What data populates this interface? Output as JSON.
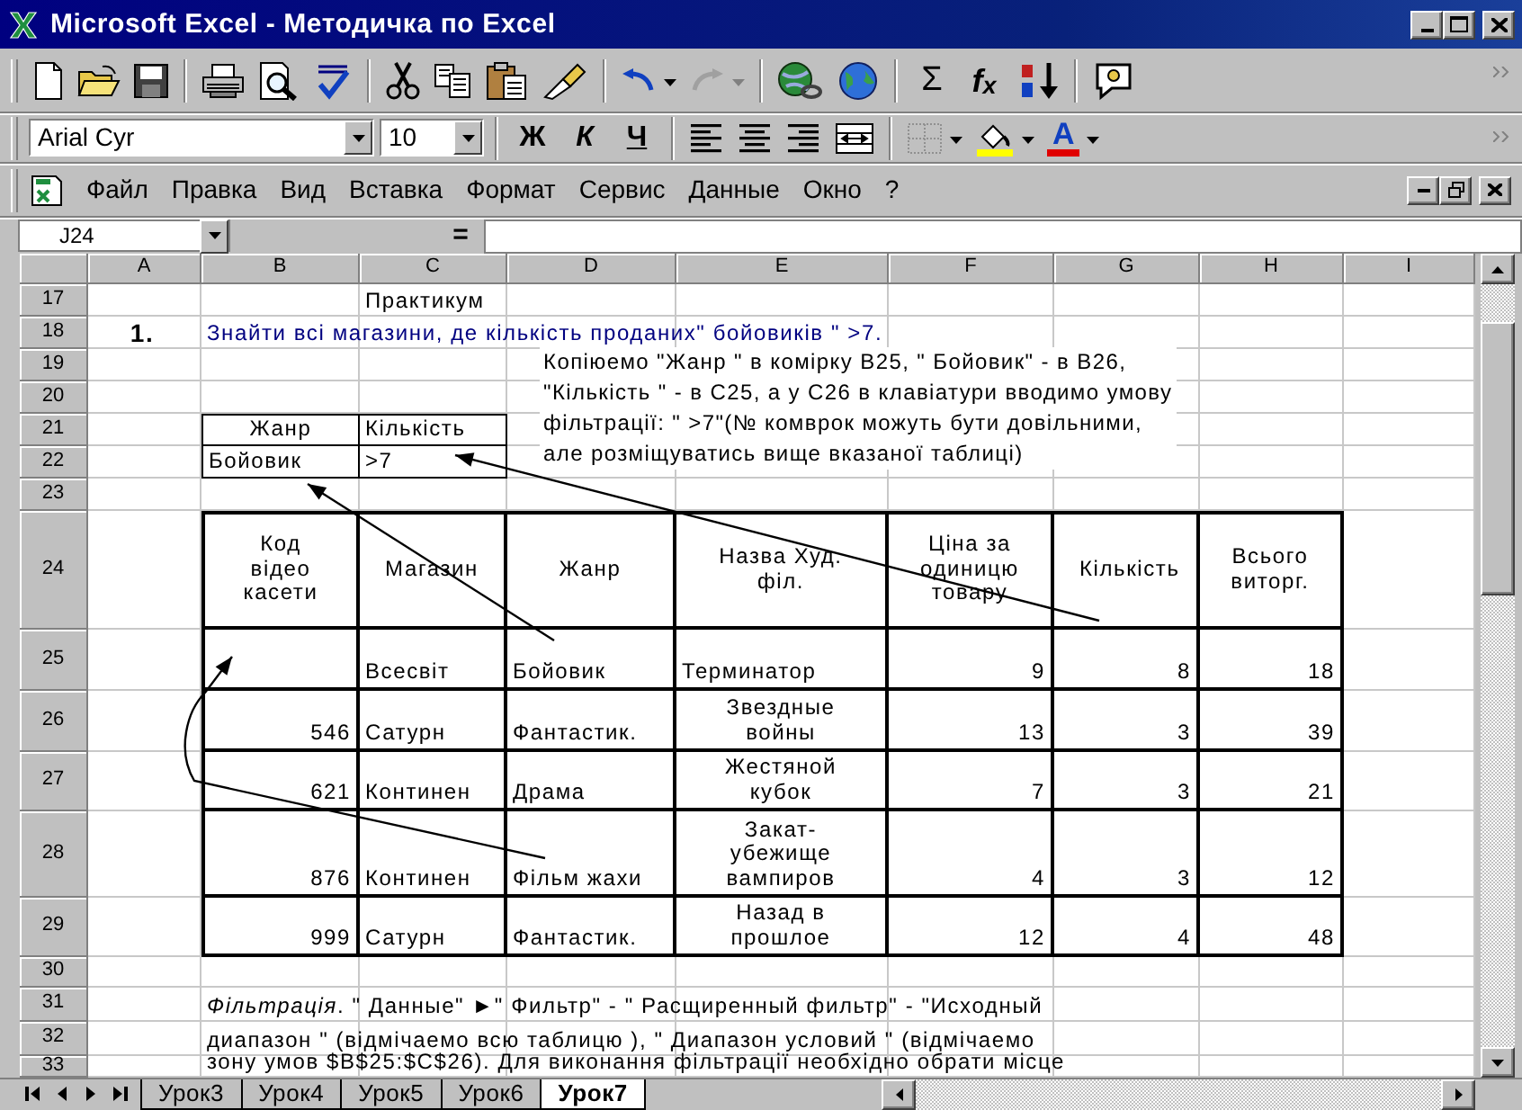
{
  "window": {
    "title": "Microsoft Excel - Методичка по Excel"
  },
  "standard_toolbar": {
    "sum_label": "Σ",
    "function_label": "f$_{x}$"
  },
  "formatting_toolbar": {
    "font": "Arial Cyr",
    "size": "10",
    "bold_label": "Ж",
    "italic_label": "К",
    "underline_label": "Ч",
    "font_color_label": "A"
  },
  "menu": [
    {
      "label": "Файл"
    },
    {
      "label": "Правка"
    },
    {
      "label": "Вид"
    },
    {
      "label": "Вставка"
    },
    {
      "label": "Формат"
    },
    {
      "label": "Сервис"
    },
    {
      "label": "Данные"
    },
    {
      "label": "Окно"
    },
    {
      "label": "?"
    }
  ],
  "formula_bar": {
    "name_box": "J24",
    "equals": "="
  },
  "sheet": {
    "columns": [
      "A",
      "B",
      "C",
      "D",
      "E",
      "F",
      "G",
      "H",
      "I"
    ],
    "rows": [
      {
        "number": "17",
        "cells": {
          "C": {
            "kind": "text",
            "text": "Практикум"
          }
        }
      },
      {
        "number": "18",
        "cells": {
          "A": {
            "kind": "index",
            "text": "1."
          },
          "B": {
            "kind": "task",
            "text": "Знайти всі магазини, де кількість проданих\" бойовиків \" >7."
          }
        }
      },
      {
        "number": "19"
      },
      {
        "number": "20"
      },
      {
        "number": "21",
        "cells": {
          "B": {
            "kind": "center",
            "text": "Жанр",
            "framed": true
          },
          "C": {
            "kind": "text",
            "text": "Кількість",
            "framed": true
          }
        }
      },
      {
        "number": "22",
        "cells": {
          "B": {
            "kind": "text",
            "text": "Бойовик",
            "framed": true
          },
          "C": {
            "kind": "text",
            "text": ">7",
            "framed": true
          }
        }
      },
      {
        "number": "23"
      },
      {
        "number": "24",
        "cells": {
          "B": {
            "kind": "heading",
            "text": "Код відео касети",
            "framed": true,
            "bold_frame": true
          },
          "C": {
            "kind": "heading",
            "text": "Магазин",
            "framed": true,
            "bold_frame": true
          },
          "D": {
            "kind": "heading",
            "text": "Жанр",
            "framed": true,
            "bold_frame": true
          },
          "E": {
            "kind": "heading",
            "text": "Назва Худ. філ.",
            "framed": true,
            "bold_frame": true
          },
          "F": {
            "kind": "heading",
            "text": "Ціна за одиницю товару",
            "framed": true,
            "bold_frame": true
          },
          "G": {
            "kind": "heading",
            "text": "Кількість",
            "framed": true,
            "bold_frame": true
          },
          "H": {
            "kind": "heading",
            "text": "Всього виторг.",
            "framed": true,
            "bold_frame": true
          }
        }
      },
      {
        "number": "25",
        "cells": {
          "B": {
            "kind": "text",
            "framed": true,
            "bold_frame": true
          },
          "C": {
            "kind": "text",
            "text": "Всесвіт",
            "framed": true,
            "bold_frame": true
          },
          "D": {
            "kind": "text",
            "text": "Бойовик",
            "framed": true,
            "bold_frame": true
          },
          "E": {
            "kind": "text",
            "text": "Терминатор",
            "framed": true,
            "bold_frame": true
          },
          "F": {
            "kind": "number",
            "text": "9",
            "framed": true,
            "bold_frame": true
          },
          "G": {
            "kind": "number",
            "text": "8",
            "framed": true,
            "bold_frame": true
          },
          "H": {
            "kind": "number",
            "text": "18",
            "framed": true,
            "bold_frame": true
          }
        }
      },
      {
        "number": "26",
        "cells": {
          "B": {
            "kind": "number",
            "text": "546",
            "framed": true,
            "bold_frame": true
          },
          "C": {
            "kind": "text",
            "text": "Сатурн",
            "framed": true,
            "bold_frame": true
          },
          "D": {
            "kind": "text",
            "text": "Фантастик.",
            "framed": true,
            "bold_frame": true
          },
          "E": {
            "kind": "wrap",
            "text": "Звездные войны",
            "framed": true,
            "bold_frame": true
          },
          "F": {
            "kind": "number",
            "text": "13",
            "framed": true,
            "bold_frame": true
          },
          "G": {
            "kind": "number",
            "text": "3",
            "framed": true,
            "bold_frame": true
          },
          "H": {
            "kind": "number",
            "text": "39",
            "framed": true,
            "bold_frame": true
          }
        }
      },
      {
        "number": "27",
        "cells": {
          "B": {
            "kind": "number",
            "text": "621",
            "framed": true,
            "bold_frame": true
          },
          "C": {
            "kind": "text",
            "text": "Континен",
            "framed": true,
            "bold_frame": true
          },
          "D": {
            "kind": "text",
            "text": "Драма",
            "framed": true,
            "bold_frame": true
          },
          "E": {
            "kind": "wrap",
            "text": "Жестяной кубок",
            "framed": true,
            "bold_frame": true
          },
          "F": {
            "kind": "number",
            "text": "7",
            "framed": true,
            "bold_frame": true
          },
          "G": {
            "kind": "number",
            "text": "3",
            "framed": true,
            "bold_frame": true
          },
          "H": {
            "kind": "number",
            "text": "21",
            "framed": true,
            "bold_frame": true
          }
        }
      },
      {
        "number": "28",
        "cells": {
          "B": {
            "kind": "number",
            "text": "876",
            "framed": true,
            "bold_frame": true
          },
          "C": {
            "kind": "text",
            "text": "Континен",
            "framed": true,
            "bold_frame": true
          },
          "D": {
            "kind": "text",
            "text": "Фільм жахи",
            "framed": true,
            "bold_frame": true
          },
          "E": {
            "kind": "wrap",
            "text": "Закат-убежище вампиров",
            "framed": true,
            "bold_frame": true
          },
          "F": {
            "kind": "number",
            "text": "4",
            "framed": true,
            "bold_frame": true
          },
          "G": {
            "kind": "number",
            "text": "3",
            "framed": true,
            "bold_frame": true
          },
          "H": {
            "kind": "number",
            "text": "12",
            "framed": true,
            "bold_frame": true
          }
        }
      },
      {
        "number": "29",
        "cells": {
          "B": {
            "kind": "number",
            "text": "999",
            "framed": true,
            "bold_frame": true
          },
          "C": {
            "kind": "text",
            "text": "Сатурн",
            "framed": true,
            "bold_frame": true
          },
          "D": {
            "kind": "text",
            "text": "Фантастик.",
            "framed": true,
            "bold_frame": true
          },
          "E": {
            "kind": "wrap",
            "text": "Назад в прошлое",
            "framed": true,
            "bold_frame": true
          },
          "F": {
            "kind": "number",
            "text": "12",
            "framed": true,
            "bold_frame": true
          },
          "G": {
            "kind": "number",
            "text": "4",
            "framed": true,
            "bold_frame": true
          },
          "H": {
            "kind": "number",
            "text": "48",
            "framed": true,
            "bold_frame": true
          }
        }
      },
      {
        "number": "30"
      },
      {
        "number": "31",
        "cells": {
          "B": {
            "kind": "text",
            "text": "*Фільтрація*. \" Данные\"  ►\" Фильтр\"  - \" Расщиренный фильтр\" -  \"Исходный"
          }
        }
      },
      {
        "number": "32",
        "cells": {
          "B": {
            "kind": "text",
            "text": "диапазон \" (відмічаемо всю таблицю ), \" Диапазон условий \" (відмічаемо"
          }
        }
      },
      {
        "number": "33",
        "cells": {
          "B": {
            "kind": "text",
            "text": "зону умов $B$25:$C$26). Для виконання фільтрації необхідно обрати місце"
          }
        }
      }
    ],
    "note": {
      "lines": [
        "Копіюемо \"Жанр \" в комірку B25, \" Бойовик\" - в B26,",
        "\"Кількість \" - в C25, а у C26 в клавіатури вводимо умову",
        "фільтрації: \" >7\"(№ комврок можуть бути довільними,",
        "але розміщуватись вище вказаної таблиці)"
      ]
    }
  },
  "sheet_tabs": [
    {
      "label": "Урок3",
      "selected": false
    },
    {
      "label": "Урок4",
      "selected": false
    },
    {
      "label": "Урок5",
      "selected": false
    },
    {
      "label": "Урок6",
      "selected": false
    },
    {
      "label": "Урок7",
      "selected": true
    }
  ]
}
